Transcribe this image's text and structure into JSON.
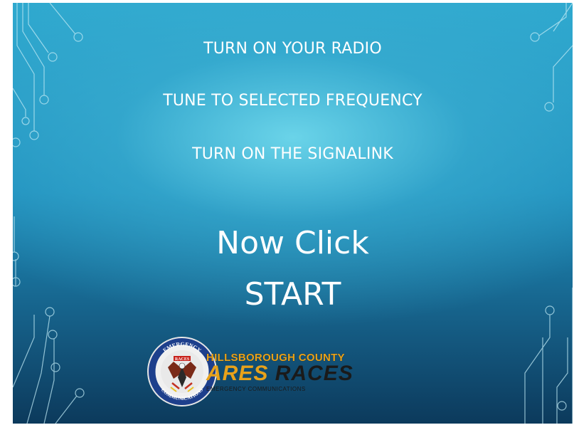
{
  "slide": {
    "instructions": [
      "TURN ON YOUR RADIO",
      "TUNE TO SELECTED FREQUENCY",
      "TURN ON THE SIGNALINK"
    ],
    "headline_line1": "Now Click",
    "headline_line2": "START"
  },
  "logo": {
    "seal_top_text": "EMERGENCY",
    "seal_center_text": "RACES",
    "seal_bottom_text": "COMMUNICATIONS",
    "org_line": "HILLSBOROUGH COUNTY",
    "ares": "ARES",
    "races": "RACES",
    "sub_line": "EMERGENCY COMMUNICATIONS"
  },
  "colors": {
    "background_light": "#6fd7eb",
    "background_dark": "#0c3a5c",
    "text": "#ffffff",
    "logo_accent": "#e8a21a"
  }
}
